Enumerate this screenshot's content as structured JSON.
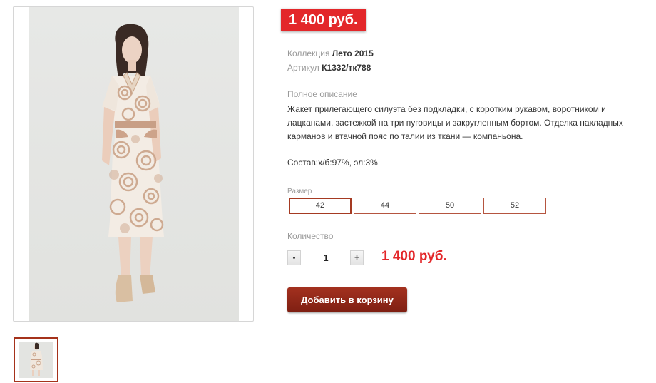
{
  "product": {
    "price_tag": "1 400 руб.",
    "collection_label": "Коллекция",
    "collection_value": "Лето 2015",
    "article_label": "Артикул",
    "article_value": "К1332/тк788"
  },
  "description": {
    "label": "Полное описание",
    "lines": [
      "Жакет прилегающего силуэта без подкладки, с коротким рукавом, воротником и",
      "лацканами, застежкой на три пуговицы и закругленным бортом. Отделка накладных",
      "карманов и втачной пояс по талии из ткани — компаньона."
    ],
    "composition": "Состав:х/б:97%, эл:3%"
  },
  "sizes": {
    "label": "Размер",
    "options": [
      "42",
      "44",
      "50",
      "52"
    ],
    "selected": "42"
  },
  "quantity": {
    "label": "Количество",
    "minus": "-",
    "value": "1",
    "plus": "+",
    "total": "1 400 руб."
  },
  "cart": {
    "button_label": "Добавить в корзину"
  },
  "colors": {
    "price_red": "#e3272a",
    "accent_dark_red": "#a3311f",
    "border_brown": "#b55540"
  }
}
